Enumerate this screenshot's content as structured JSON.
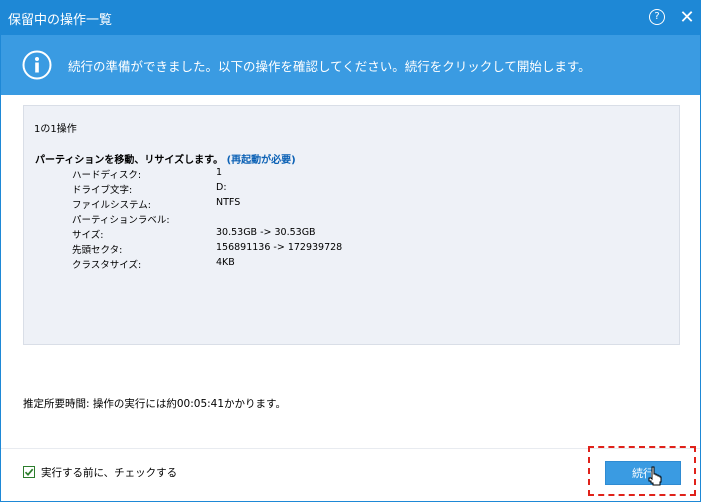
{
  "window": {
    "title": "保留中の操作一覧",
    "help_icon": "help-icon",
    "close_icon": "close-icon"
  },
  "banner": {
    "text": "続行の準備ができました。以下の操作を確認してください。続行をクリックして開始します。",
    "icon": "info-icon"
  },
  "operations": {
    "count_text": "1の1操作",
    "title_prefix": "パーティションを移動、リサイズします。",
    "title_suffix": "(再起動が必要)",
    "details": [
      {
        "label": "ハードディスク:",
        "value": "1"
      },
      {
        "label": "ドライブ文字:",
        "value": "D:"
      },
      {
        "label": "ファイルシステム:",
        "value": "NTFS"
      },
      {
        "label": "パーティションラベル:",
        "value": ""
      },
      {
        "label": "サイズ:",
        "value": "30.53GB -> 30.53GB"
      },
      {
        "label": "先頭セクタ:",
        "value": "156891136 -> 172939728"
      },
      {
        "label": "クラスタサイズ:",
        "value": "4KB"
      }
    ]
  },
  "eta_text": "推定所要時間: 操作の実行には約00:05:41かかります。",
  "footer": {
    "checkbox_label": "実行する前に、チェックする",
    "checkbox_checked": true,
    "continue_label": "続行"
  },
  "colors": {
    "titlebar": "#1e88d6",
    "banner": "#3a9be2",
    "accent_text": "#0b61b5",
    "highlight": "#e0221a",
    "checkbox": "#2c7d2c"
  }
}
